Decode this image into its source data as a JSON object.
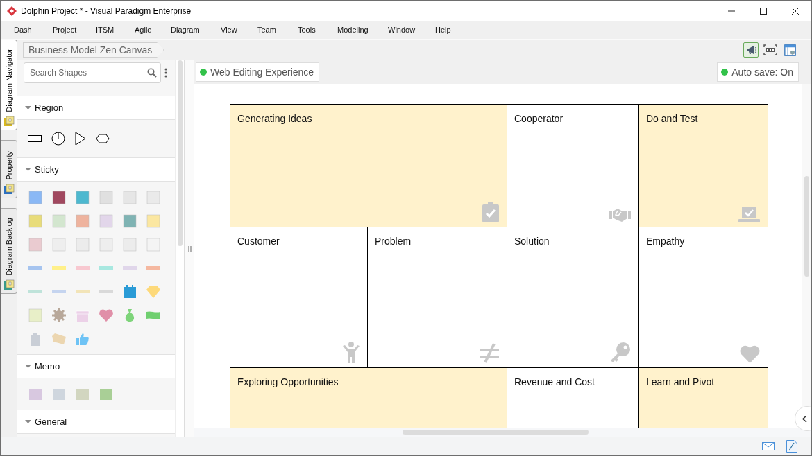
{
  "window": {
    "title": "Dolphin Project * - Visual Paradigm Enterprise"
  },
  "menu": [
    "Dash",
    "Project",
    "ITSM",
    "Agile",
    "Diagram",
    "View",
    "Team",
    "Tools",
    "Modeling",
    "Window",
    "Help"
  ],
  "side_tabs": [
    {
      "label": "Diagram Navigator",
      "selected": true
    },
    {
      "label": "Property",
      "selected": false
    },
    {
      "label": "Diagram Backlog",
      "selected": false
    }
  ],
  "breadcrumb": "Business Model Zen Canvas",
  "toolbar_buttons": [
    {
      "selected": true
    },
    {
      "selected": false
    },
    {
      "selected": false
    }
  ],
  "palette": {
    "search": {
      "placeholder": "Search Shapes"
    },
    "sections": [
      {
        "title": "Region",
        "kind": "region"
      },
      {
        "title": "Sticky",
        "kind": "sticky"
      },
      {
        "title": "Memo",
        "kind": "memo"
      },
      {
        "title": "General",
        "kind": "general"
      }
    ]
  },
  "status_chips": [
    "Web Editing Experience",
    "Auto save: On"
  ],
  "canvas": {
    "cells": [
      {
        "title": "Generating Ideas",
        "wide": true,
        "tinted": true
      },
      {
        "title": "Cooperator",
        "wide": false,
        "tinted": false
      },
      {
        "title": "Do and Test",
        "wide": false,
        "tinted": true
      },
      {
        "title": "Customer",
        "wide": false,
        "tinted": false
      },
      {
        "title": "Problem",
        "wide": false,
        "tinted": false
      },
      {
        "title": "Solution",
        "wide": false,
        "tinted": false
      },
      {
        "title": "Empathy",
        "wide": false,
        "tinted": false
      },
      {
        "title": "Exploring Opportunities",
        "wide": true,
        "tinted": true
      },
      {
        "title": "Revenue and Cost",
        "wide": false,
        "tinted": false
      },
      {
        "title": "Learn and Pivot",
        "wide": false,
        "tinted": true
      }
    ]
  }
}
